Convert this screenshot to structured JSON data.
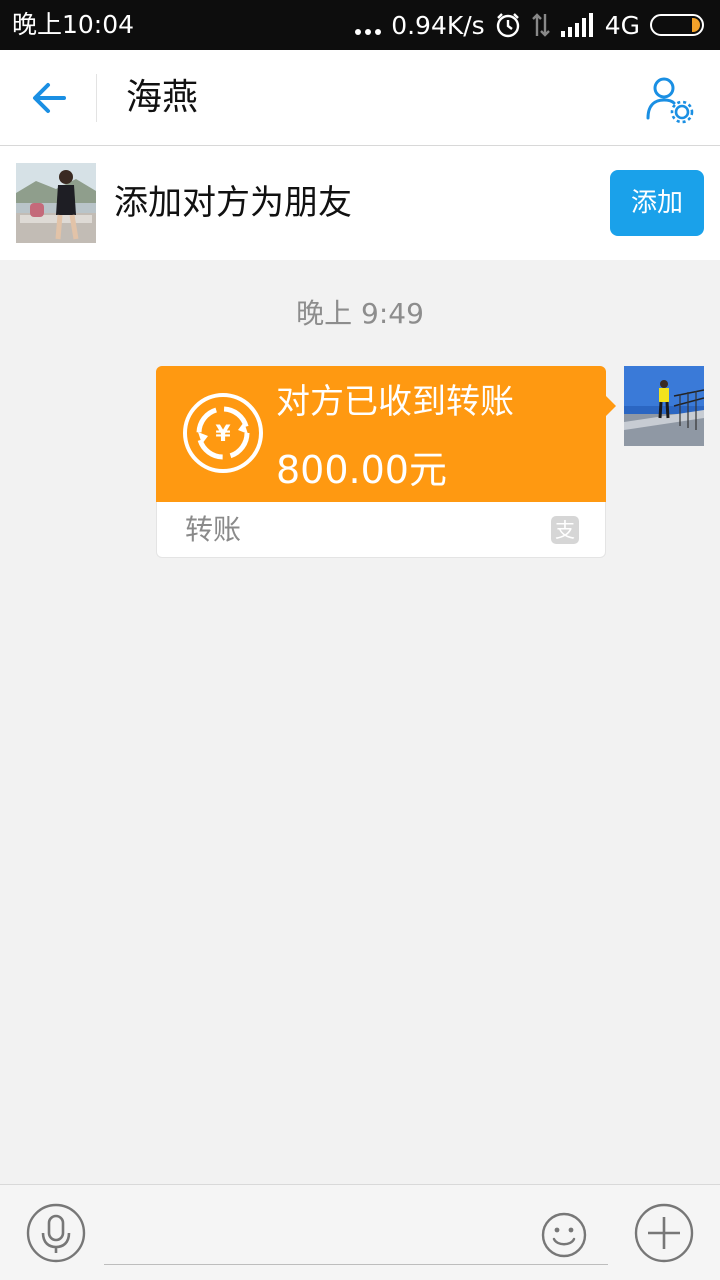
{
  "status_bar": {
    "time": "晚上10:04",
    "net_speed": "0.94K/s",
    "network": "4G",
    "icons": [
      "more-dots-icon",
      "alarm-icon",
      "data-arrows-icon",
      "signal-icon",
      "battery-icon"
    ]
  },
  "header": {
    "title": "海燕",
    "back_icon": "back-arrow-icon",
    "profile_icon": "profile-settings-icon"
  },
  "add_friend": {
    "text": "添加对方为朋友",
    "button_label": "添加"
  },
  "chat": {
    "timestamp": "晚上 9:49",
    "transfer": {
      "status": "对方已收到转账",
      "amount": "800.00元",
      "label": "转账",
      "accent_color": "#ff9911"
    }
  },
  "input_bar": {
    "voice_icon": "microphone-icon",
    "emoji_icon": "emoji-icon",
    "plus_icon": "plus-icon"
  },
  "colors": {
    "primary": "#1aa1ea",
    "background": "#f2f2f2"
  }
}
